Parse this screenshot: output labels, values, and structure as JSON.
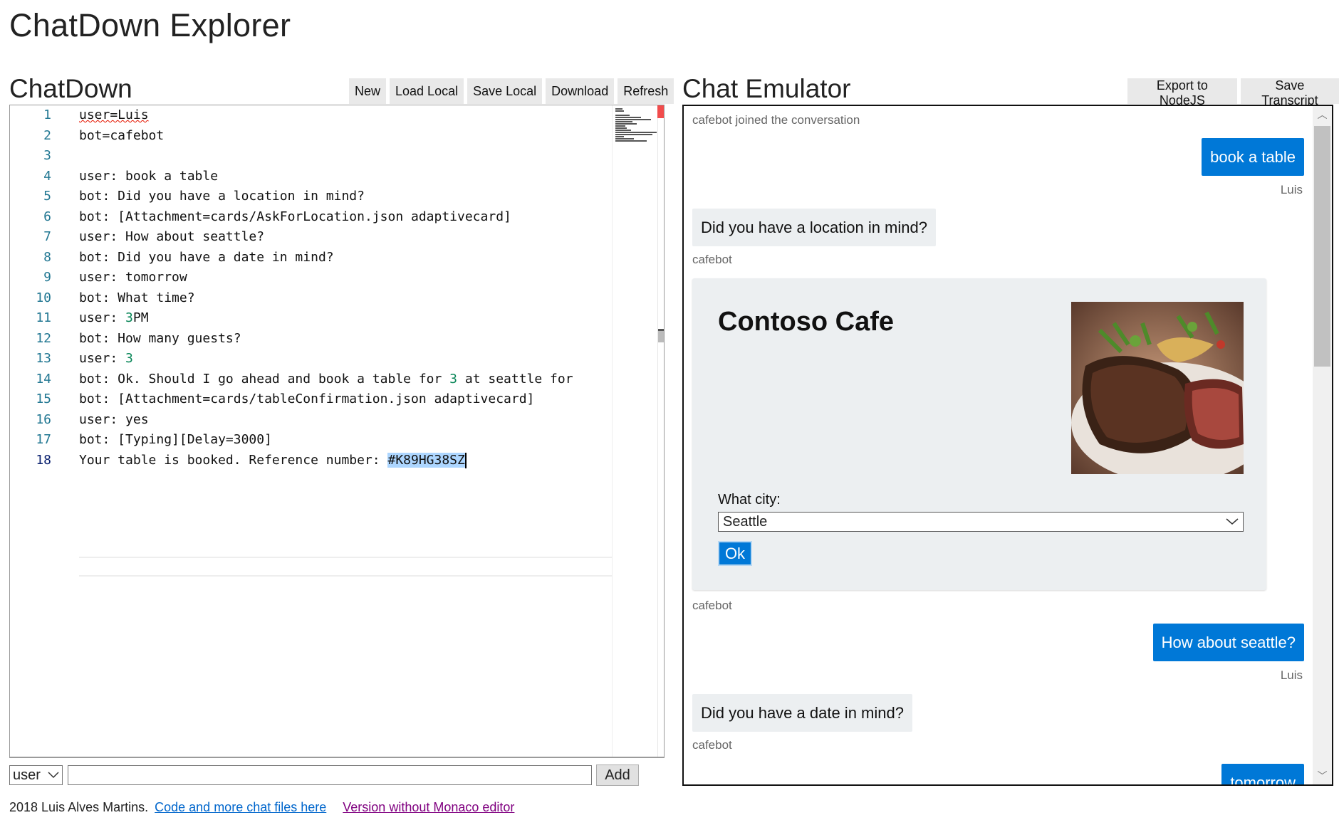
{
  "app": {
    "title": "ChatDown Explorer"
  },
  "editor_pane": {
    "title": "ChatDown",
    "toolbar": [
      "New",
      "Load Local",
      "Save Local",
      "Download",
      "Refresh"
    ],
    "line_numbers": [
      "1",
      "2",
      "3",
      "4",
      "5",
      "6",
      "7",
      "8",
      "9",
      "10",
      "11",
      "12",
      "13",
      "14",
      "15",
      "16",
      "17",
      "18"
    ],
    "lines": {
      "l1": "user=Luis",
      "l2": "bot=cafebot",
      "l3": "",
      "l4": "user: book a table",
      "l5": "bot: Did you have a location in mind?",
      "l6": "bot: [Attachment=cards/AskForLocation.json adaptivecard]",
      "l7": "user: How about seattle?",
      "l8": "bot: Did you have a date in mind?",
      "l9": "user: tomorrow",
      "l10": "bot: What time?",
      "l11a": "user: ",
      "l11b": "3",
      "l11c": "PM",
      "l12": "bot: How many guests?",
      "l13a": "user: ",
      "l13b": "3",
      "l14a": "bot: Ok. Should I go ahead and book a table for ",
      "l14b": "3",
      "l14c": " at seattle for",
      "l15": "bot: [Attachment=cards/tableConfirmation.json adaptivecard]",
      "l16": "user: yes",
      "l17": "bot: [Typing][Delay=3000]",
      "l18a": "Your table is booked. Reference number: ",
      "l18b": "#K89HG38SZ"
    },
    "input_row": {
      "role_select": "user",
      "message_value": "",
      "add_label": "Add"
    }
  },
  "footer": {
    "text": "2018 Luis Alves Martins.",
    "link1": "Code and more chat files here",
    "link2": "Version without Monaco editor"
  },
  "chat_pane": {
    "title": "Chat Emulator",
    "toolbar": [
      "Export to NodeJS",
      "Save Transcript"
    ],
    "system_message": "cafebot joined the conversation",
    "messages": {
      "m1": "book a table",
      "m1_from": "Luis",
      "m2": "Did you have a location in mind?",
      "m2_from": "cafebot",
      "m3_from": "cafebot",
      "m4": "How about seattle?",
      "m4_from": "Luis",
      "m5": "Did you have a date in mind?",
      "m5_from": "cafebot",
      "m6": "tomorrow"
    },
    "card": {
      "title": "Contoso Cafe",
      "label": "What city:",
      "selected_city": "Seattle",
      "ok_label": "Ok"
    }
  },
  "colors": {
    "accent_blue": "#0078d7",
    "bot_bubble": "#eceff1",
    "line_number": "#237893",
    "number_literal": "#098658"
  }
}
